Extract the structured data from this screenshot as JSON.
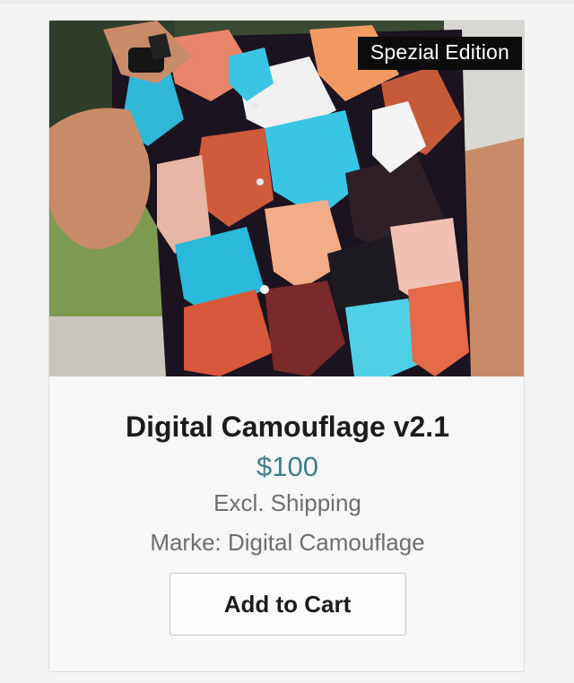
{
  "product": {
    "badge": "Spezial Edition",
    "title": "Digital Camouflage v2.1",
    "price": "$100",
    "shipping": "Excl. Shipping",
    "brand_line": "Marke: Digital Camouflage",
    "add_to_cart_label": "Add to Cart"
  },
  "colors": {
    "price": "#3f7f86",
    "badge_bg": "#0c0c0c",
    "title": "#1c1c1c",
    "muted": "#6e6e6e"
  }
}
